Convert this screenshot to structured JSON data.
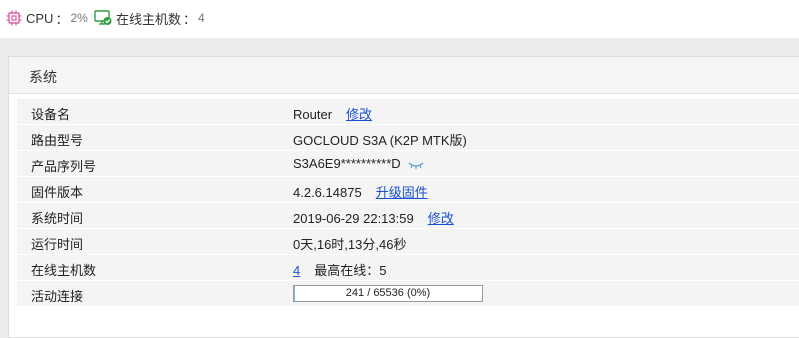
{
  "topbar": {
    "cpu_label": "CPU",
    "cpu_sep": "：",
    "cpu_value": "2%",
    "hosts_label": "在线主机数",
    "hosts_sep": "：",
    "hosts_value": "4",
    "cpu_icon_color": "#e05aa0",
    "hosts_icon_color": "#2e9e3e"
  },
  "panel": {
    "title": "系统",
    "rows": [
      {
        "key": "设备名",
        "value": "Router",
        "link": "修改"
      },
      {
        "key": "路由型号",
        "value": "GOCLOUD S3A (K2P MTK版)"
      },
      {
        "key": "产品序列号",
        "value": "S3A6E9**********D"
      },
      {
        "key": "固件版本",
        "value": "4.2.6.14875",
        "link": "升级固件"
      },
      {
        "key": "系统时间",
        "value": "2019-06-29 22:13:59",
        "link": "修改"
      },
      {
        "key": "运行时间",
        "value": "0天,16时,13分,46秒"
      },
      {
        "key": "在线主机数",
        "value": "4",
        "extra": "最高在线：5"
      },
      {
        "key": "活动连接",
        "progress_text": "241 / 65536 (0%)",
        "progress_fraction": 0.0037
      }
    ]
  }
}
